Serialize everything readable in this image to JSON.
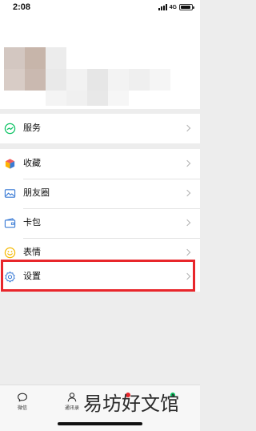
{
  "status_bar": {
    "time": "2:08",
    "network": "4G"
  },
  "menu": {
    "services": {
      "label": "服务",
      "icon": "services-icon",
      "color": "#07c160"
    },
    "favorites": {
      "label": "收藏",
      "icon": "cube-icon"
    },
    "moments": {
      "label": "朋友圈",
      "icon": "photo-icon",
      "color": "#3a7bd5"
    },
    "cards": {
      "label": "卡包",
      "icon": "wallet-icon",
      "color": "#3a7bd5"
    },
    "stickers": {
      "label": "表情",
      "icon": "smiley-icon",
      "color": "#f5b800"
    },
    "settings": {
      "label": "设置",
      "icon": "gear-icon",
      "color": "#3a7bd5"
    }
  },
  "highlight_color": "#e8262b",
  "tabbar": {
    "chats": {
      "label": "微信",
      "icon": "chat-bubble-icon"
    },
    "contacts": {
      "label": "通讯录",
      "icon": "contacts-icon"
    }
  },
  "watermark": "易坊好文馆"
}
